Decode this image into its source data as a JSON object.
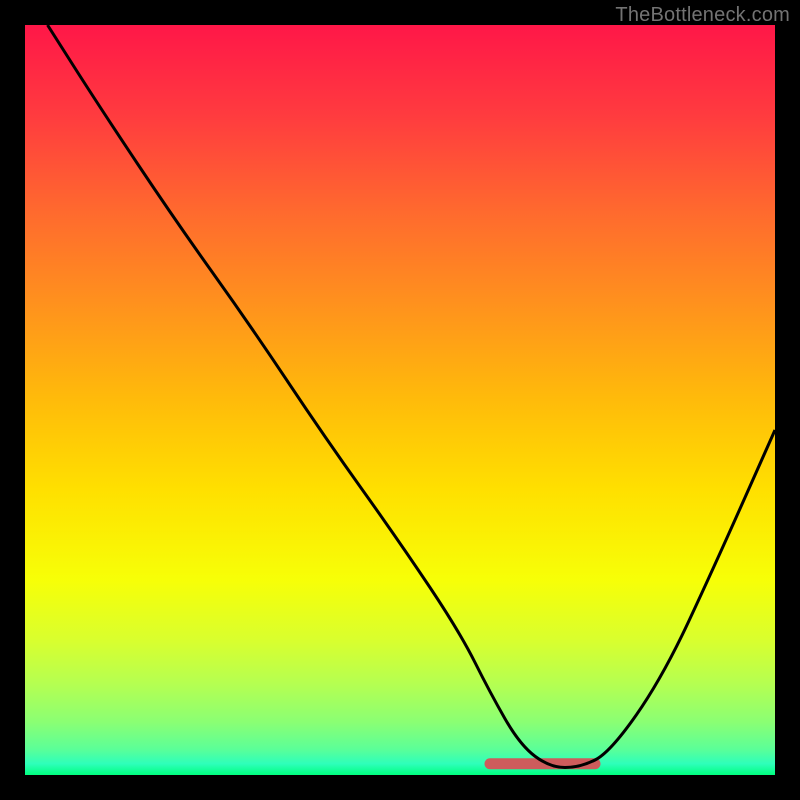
{
  "attribution": "TheBottleneck.com",
  "colors": {
    "black": "#000000",
    "curve": "#000000",
    "attribution_text": "#737373",
    "minimum_band": "#cd5c5c",
    "gradient_stops": [
      {
        "offset": 0.0,
        "color": "#ff1748"
      },
      {
        "offset": 0.12,
        "color": "#ff3b3f"
      },
      {
        "offset": 0.25,
        "color": "#ff6a2e"
      },
      {
        "offset": 0.38,
        "color": "#ff941c"
      },
      {
        "offset": 0.5,
        "color": "#ffbb0a"
      },
      {
        "offset": 0.62,
        "color": "#ffe000"
      },
      {
        "offset": 0.74,
        "color": "#f7ff07"
      },
      {
        "offset": 0.82,
        "color": "#d9ff2e"
      },
      {
        "offset": 0.88,
        "color": "#b4ff52"
      },
      {
        "offset": 0.93,
        "color": "#8aff74"
      },
      {
        "offset": 0.965,
        "color": "#5cff97"
      },
      {
        "offset": 0.985,
        "color": "#2effba"
      },
      {
        "offset": 1.0,
        "color": "#00ff7f"
      }
    ]
  },
  "chart_data": {
    "type": "line",
    "title": "",
    "xlabel": "",
    "ylabel": "",
    "xlim": [
      0,
      100
    ],
    "ylim": [
      0,
      100
    ],
    "grid": false,
    "series": [
      {
        "name": "bottleneck-curve",
        "x": [
          3,
          10,
          20,
          30,
          40,
          50,
          58,
          62,
          66,
          70,
          74,
          78,
          85,
          92,
          100
        ],
        "values": [
          100,
          89,
          74,
          60,
          45,
          31,
          19,
          11,
          4,
          1,
          1,
          3,
          13,
          28,
          46
        ]
      }
    ],
    "annotations": [
      {
        "name": "minimum-band",
        "x_start": 62,
        "x_end": 76,
        "y": 1.5,
        "color_key": "minimum_band"
      }
    ]
  }
}
